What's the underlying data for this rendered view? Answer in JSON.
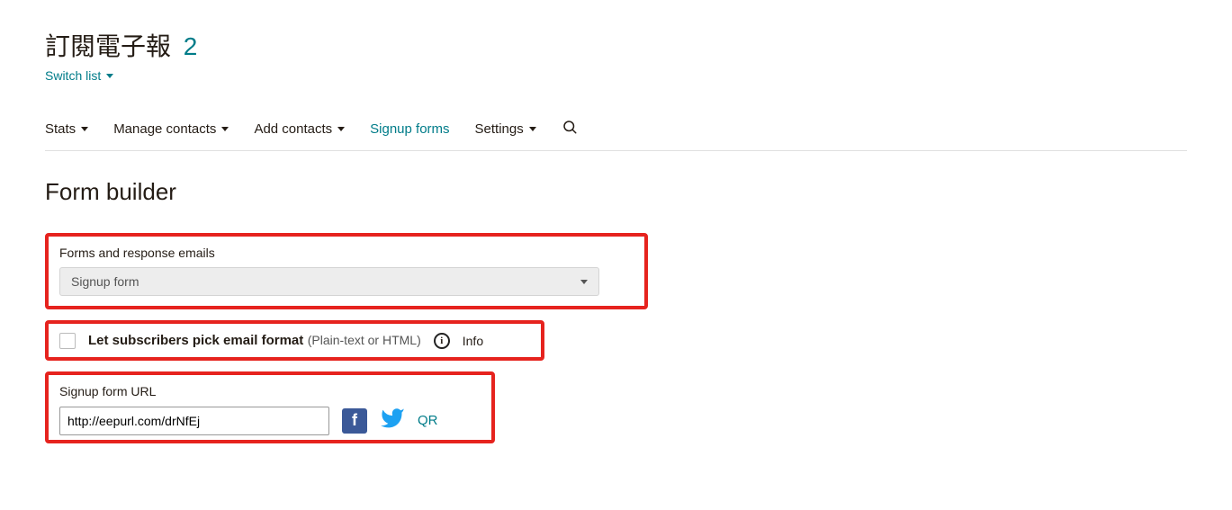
{
  "header": {
    "title": "訂閱電子報",
    "count": "2",
    "switchList": "Switch list"
  },
  "nav": {
    "stats": "Stats",
    "manageContacts": "Manage contacts",
    "addContacts": "Add contacts",
    "signupForms": "Signup forms",
    "settings": "Settings"
  },
  "page": {
    "title": "Form builder"
  },
  "forms": {
    "sectionLabel": "Forms and response emails",
    "selected": "Signup form"
  },
  "option": {
    "labelMain": "Let subscribers pick email format",
    "labelSub": "(Plain-text or HTML)",
    "infoText": "Info"
  },
  "signupUrl": {
    "label": "Signup form URL",
    "value": "http://eepurl.com/drNfEj",
    "qr": "QR"
  }
}
